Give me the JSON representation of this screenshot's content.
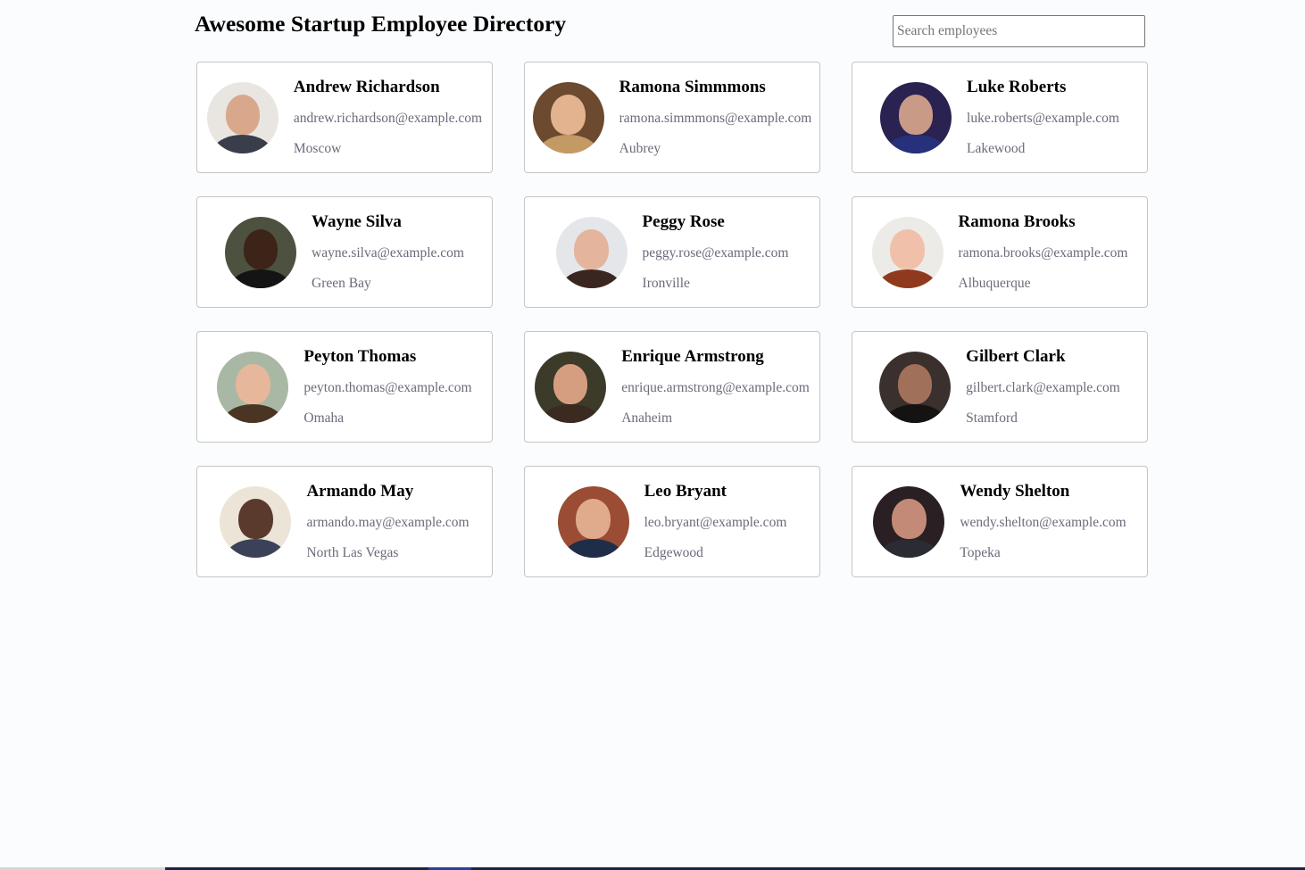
{
  "header": {
    "title": "Awesome Startup Employee Directory",
    "search_placeholder": "Search employees",
    "search_value": ""
  },
  "employees": [
    {
      "name": "Andrew Richardson",
      "email": "andrew.richardson@example.com",
      "city": "Moscow",
      "avatar": {
        "bg": "#e9e6e2",
        "skin": "#d9a88c",
        "clothes": "#3a3d4a"
      }
    },
    {
      "name": "Ramona Simmmons",
      "email": "ramona.simmmons@example.com",
      "city": "Aubrey",
      "avatar": {
        "bg": "#6b4a2f",
        "skin": "#e3b28f",
        "clothes": "#c49a64"
      }
    },
    {
      "name": "Luke Roberts",
      "email": "luke.roberts@example.com",
      "city": "Lakewood",
      "avatar": {
        "bg": "#2a2250",
        "skin": "#c99a86",
        "clothes": "#27307a"
      }
    },
    {
      "name": "Wayne Silva",
      "email": "wayne.silva@example.com",
      "city": "Green Bay",
      "avatar": {
        "bg": "#4d5140",
        "skin": "#3d2418",
        "clothes": "#141414"
      }
    },
    {
      "name": "Peggy Rose",
      "email": "peggy.rose@example.com",
      "city": "Ironville",
      "avatar": {
        "bg": "#e4e6ea",
        "skin": "#e4b49c",
        "clothes": "#3a2620"
      }
    },
    {
      "name": "Ramona Brooks",
      "email": "ramona.brooks@example.com",
      "city": "Albuquerque",
      "avatar": {
        "bg": "#ecebe8",
        "skin": "#f0c0aa",
        "clothes": "#8f3a1e"
      }
    },
    {
      "name": "Peyton Thomas",
      "email": "peyton.thomas@example.com",
      "city": "Omaha",
      "avatar": {
        "bg": "#a9b8a4",
        "skin": "#e7b79b",
        "clothes": "#4a3424"
      }
    },
    {
      "name": "Enrique Armstrong",
      "email": "enrique.armstrong@example.com",
      "city": "Anaheim",
      "avatar": {
        "bg": "#3c3b2a",
        "skin": "#d69e80",
        "clothes": "#3b2a20"
      }
    },
    {
      "name": "Gilbert Clark",
      "email": "gilbert.clark@example.com",
      "city": "Stamford",
      "avatar": {
        "bg": "#3a302d",
        "skin": "#a0705a",
        "clothes": "#151212"
      }
    },
    {
      "name": "Armando May",
      "email": "armando.may@example.com",
      "city": "North Las Vegas",
      "avatar": {
        "bg": "#ede4d8",
        "skin": "#5a3a2c",
        "clothes": "#3b4258"
      }
    },
    {
      "name": "Leo Bryant",
      "email": "leo.bryant@example.com",
      "city": "Edgewood",
      "avatar": {
        "bg": "#9a4c34",
        "skin": "#e0aa8c",
        "clothes": "#1f2e48"
      }
    },
    {
      "name": "Wendy Shelton",
      "email": "wendy.shelton@example.com",
      "city": "Topeka",
      "avatar": {
        "bg": "#2a1f22",
        "skin": "#c38a78",
        "clothes": "#2b2b33"
      }
    }
  ]
}
